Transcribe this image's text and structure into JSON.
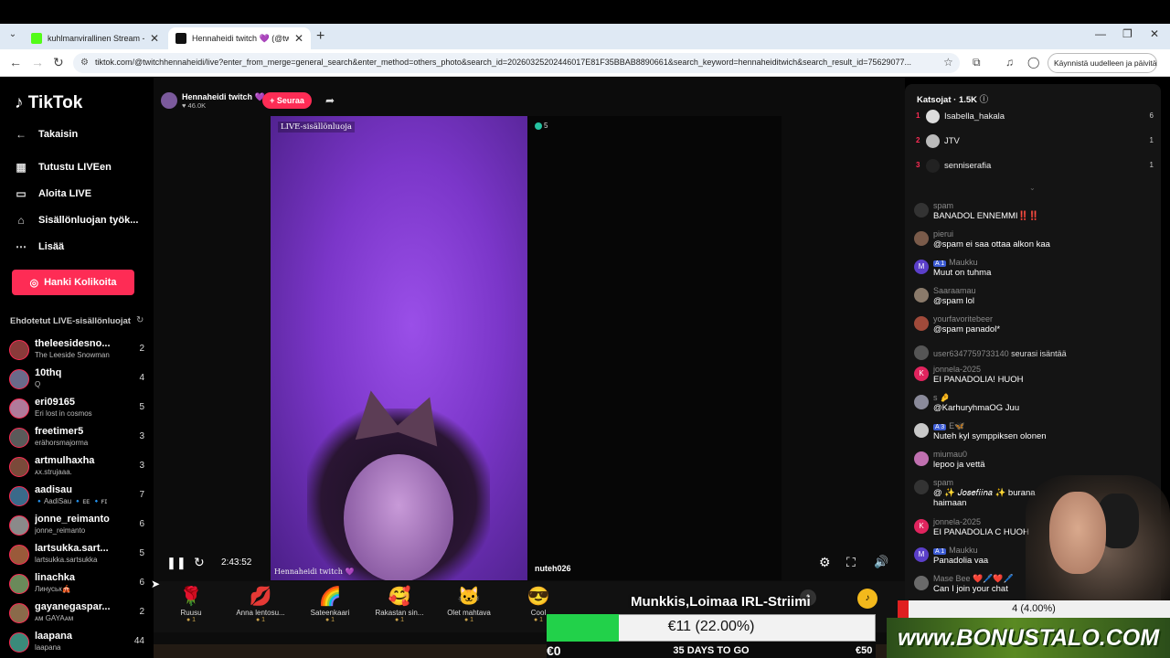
{
  "browser": {
    "tabs": [
      {
        "title": "kuhlmanvirallinen Stream - Wat",
        "active": false
      },
      {
        "title": "Hennaheidi twitch 💜 (@twi",
        "active": true
      }
    ],
    "url": "tiktok.com/@twitchhennaheidi/live?enter_from_merge=general_search&enter_method=others_photo&search_id=20260325202446017E81F35BBAB8890661&search_keyword=hennaheiditwich&search_result_id=75629077...",
    "restart_label": "Käynnistä uudelleen ja päivitä"
  },
  "sidebar": {
    "logo": "TikTok",
    "back": "Takaisin",
    "nav": [
      {
        "label": "Tutustu LIVEen",
        "icon": "calendar-icon"
      },
      {
        "label": "Aloita LIVE",
        "icon": "video-camera-icon"
      },
      {
        "label": "Sisällönluojan työk...",
        "icon": "home-icon"
      },
      {
        "label": "Lisää",
        "icon": "more-icon"
      }
    ],
    "coins_button": "Hanki Kolikoita",
    "suggested_title": "Ehdotetut LIVE-sisällönluojat",
    "creators": [
      {
        "name": "theleesidesno...",
        "sub": "The Leeside Snowman",
        "count": "2"
      },
      {
        "name": "10thq",
        "sub": "Q",
        "count": "4"
      },
      {
        "name": "eri09165",
        "sub": "Eri lost in cosmos",
        "count": "5"
      },
      {
        "name": "freetimer5",
        "sub": "erähorsmajorma",
        "count": "3"
      },
      {
        "name": "artmulhaxha",
        "sub": "ᴀx.strujaaa.",
        "count": "3"
      },
      {
        "name": "aadisau",
        "sub": "🔹AadiSau 🔹ᴇᴇ 🔹ꜰɪ",
        "count": "7"
      },
      {
        "name": "jonne_reimanto",
        "sub": "jonne_reimanto",
        "count": "6"
      },
      {
        "name": "lartsukka.sart...",
        "sub": "lartsukka.sartsukka",
        "count": "5"
      },
      {
        "name": "linachka",
        "sub": "Линуськ🎪",
        "count": "6"
      },
      {
        "name": "gayanegaspar...",
        "sub": "ᴀᴍ GAYAᴀᴍ",
        "count": "2"
      },
      {
        "name": "laapana",
        "sub": "laapana",
        "count": "44"
      }
    ]
  },
  "stream": {
    "host_name": "Hennaheidi twitch 💜",
    "host_likes": "46.0K",
    "follow_label": "+ Seuraa",
    "live_label": "LIVE-sisällönluoja",
    "guest_count": "5",
    "guest_name": "nuteh026",
    "host_tag": "Hennaheidi twitch 💜",
    "elapsed": "2:43:52"
  },
  "gifts": [
    {
      "name": "Ruusu",
      "icon": "🌹",
      "cost": "1"
    },
    {
      "name": "Anna lentosu...",
      "icon": "💋",
      "cost": "1"
    },
    {
      "name": "Sateenkaari",
      "icon": "🌈",
      "cost": "1"
    },
    {
      "name": "Rakastan sin...",
      "icon": "🥰",
      "cost": "1"
    },
    {
      "name": "Olet mahtava",
      "icon": "🐱",
      "cost": "1"
    },
    {
      "name": "Cool",
      "icon": "😎",
      "cost": "1"
    }
  ],
  "overlay": {
    "goal_title": "Munkkis,Loimaa IRL-Striimi",
    "goal_amount": "€11 (22.00%)",
    "goal_fraction": 0.22,
    "goal_start": "€0",
    "goal_days": "35 DAYS TO GO",
    "goal_end": "€50",
    "mini_text": "4 (4.00%)",
    "mini_fraction": 0.04,
    "bonus": "www.BONUSTALO.COM"
  },
  "chat": {
    "viewers_title": "Katsojat",
    "viewers_count": "1.5K",
    "ranking": [
      {
        "rank": "1",
        "name": "Isabella_hakala",
        "score": "6"
      },
      {
        "rank": "2",
        "name": "JTV",
        "score": "1"
      },
      {
        "rank": "3",
        "name": "senniserafia",
        "score": "1"
      }
    ],
    "messages": [
      {
        "user": "spam",
        "text": "BANADOL ENNEMMI‼️‼️",
        "avatar": "",
        "badge": ""
      },
      {
        "user": "pierui",
        "text": "@spam ei saa ottaa alkon kaa",
        "avatar": "",
        "badge": ""
      },
      {
        "user": "Maukku",
        "text": "Muut on tuhma",
        "avatar": "M",
        "badge": "1"
      },
      {
        "user": "Saaraamau",
        "text": "@spam lol",
        "avatar": "",
        "badge": ""
      },
      {
        "user": "yourfavoritebeer",
        "text": "@spam panadol*",
        "avatar": "",
        "badge": ""
      },
      {
        "user": "user6347759733140",
        "text": "seurasi isäntää",
        "avatar": "",
        "badge": "",
        "inline": true
      },
      {
        "user": "jonnela-2025",
        "text": "EI PANADOLIA! HUOH",
        "avatar": "K",
        "badge": ""
      },
      {
        "user": "s 🤌",
        "text": "@KarhuryhmaOG Juu",
        "avatar": "",
        "badge": ""
      },
      {
        "user": "E🦋",
        "text": "Nuteh kyl symppiksen olonen",
        "avatar": "",
        "badge": "3"
      },
      {
        "user": "miumau0",
        "text": "lepoo ja vettä",
        "avatar": "",
        "badge": ""
      },
      {
        "user": "spam",
        "text": "@ ✨ 𝐽𝑜𝑠𝑒𝑓𝑖𝑖𝑛𝑎 ✨ burana",
        "text2": "haimaan",
        "avatar": "",
        "badge": ""
      },
      {
        "user": "jonnela-2025",
        "text": "EI PANADOLIA C HUOH",
        "avatar": "K",
        "badge": ""
      },
      {
        "user": "Maukku",
        "text": "Panadolia vaa",
        "avatar": "M",
        "badge": "1"
      },
      {
        "user": "Mase Bee ❤️🖊️❤️🖊️",
        "text": "Can I join your chat",
        "avatar": "",
        "badge": ""
      }
    ]
  },
  "colors": {
    "accent": "#fe2c55",
    "goal_green": "#22d14a",
    "mini_red": "#e02020"
  }
}
